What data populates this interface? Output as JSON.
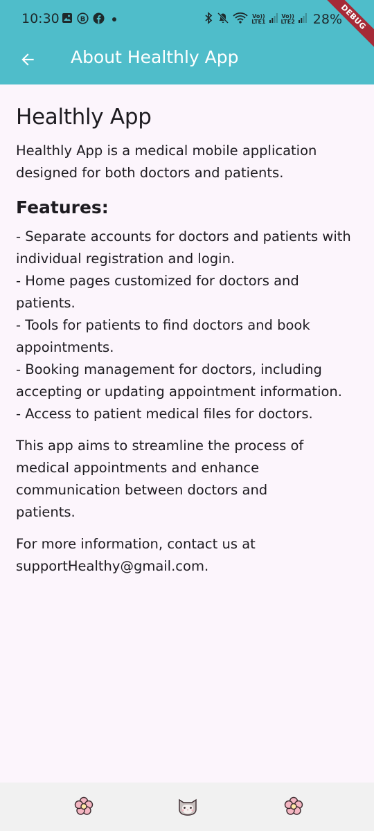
{
  "status_bar": {
    "time": "10:30",
    "battery": "28%",
    "volte1": {
      "top": "Vo))",
      "bottom": "LTE1"
    },
    "volte2": {
      "top": "Vo))",
      "bottom": "LTE2"
    }
  },
  "debug_banner": "DEBUG",
  "app_bar": {
    "title": "About Healthly App",
    "background_color": "#4fbdca"
  },
  "content": {
    "title": "Healthly App",
    "intro": "Healthly App is a medical mobile application\ndesigned for both doctors and patients.",
    "features_heading": "Features:",
    "features": [
      "- Separate accounts for doctors and patients with individual registration and login.",
      "- Home pages customized for doctors and patients.",
      "- Tools for patients to find doctors and book appointments.",
      "- Booking management for doctors, including accepting or updating appointment information.",
      "- Access to patient medical files for doctors."
    ],
    "aim": "This app aims to streamline the process of\nmedical appointments and enhance\ncommunication between doctors and\npatients.",
    "contact": "For more information, contact us at\nsupportHealthy@gmail.com."
  },
  "bottom_nav": {
    "items": [
      {
        "icon": "flower-icon"
      },
      {
        "icon": "cat-face-icon"
      },
      {
        "icon": "flower-icon"
      }
    ]
  }
}
